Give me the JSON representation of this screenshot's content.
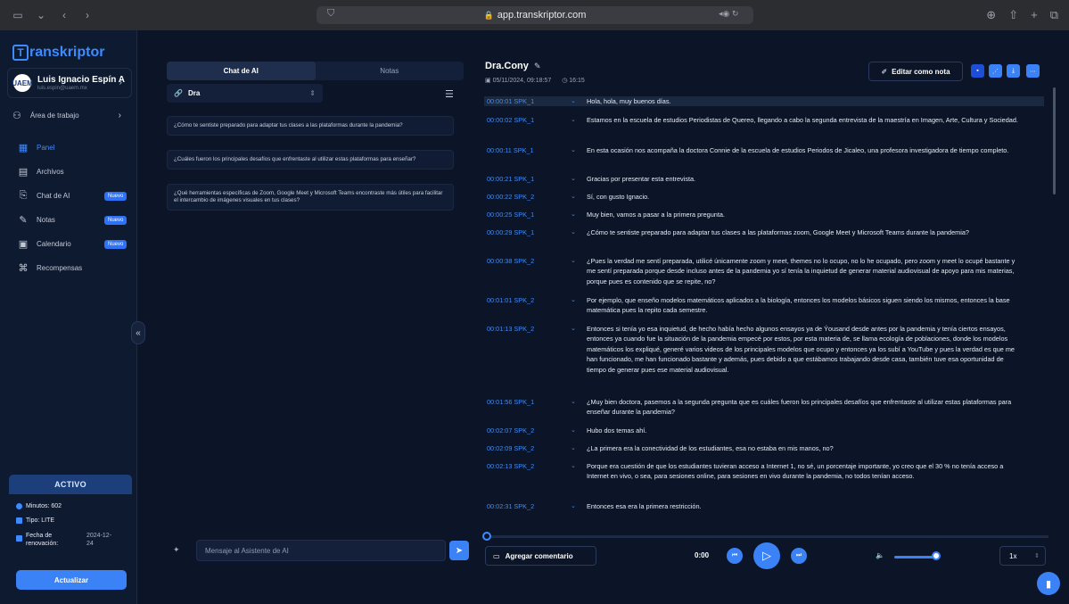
{
  "browser": {
    "url": "app.transkriptor.com"
  },
  "sidebar": {
    "logo_text": "ranskriptor",
    "logo_mark": "T",
    "user_name": "Luis Ignacio Espín A",
    "user_email": "luis.espin@uaem.mx",
    "workspace_label": "Área de trabajo",
    "nav": [
      {
        "label": "Panel",
        "icon": "grid-icon",
        "active": true,
        "badge": ""
      },
      {
        "label": "Archivos",
        "icon": "file-icon",
        "active": false,
        "badge": ""
      },
      {
        "label": "Chat de AI",
        "icon": "chat-icon",
        "active": false,
        "badge": "Nuevo"
      },
      {
        "label": "Notas",
        "icon": "note-icon",
        "active": false,
        "badge": "Nuevo"
      },
      {
        "label": "Calendario",
        "icon": "calendar-icon",
        "active": false,
        "badge": "Nuevo"
      },
      {
        "label": "Recompensas",
        "icon": "gift-icon",
        "active": false,
        "badge": ""
      }
    ],
    "plan": {
      "status": "ACTIVO",
      "minutes": "Minutos: 602",
      "type": "Tipo: LITE",
      "renewal_label": "Fecha de renovación:",
      "renewal_date": "2024-12-24",
      "upgrade": "Actualizar"
    }
  },
  "chat": {
    "tabs": [
      "Chat de AI",
      "Notas"
    ],
    "filter_value": "Dra",
    "questions": [
      "¿Cómo te sentiste preparado para adaptar tus clases a las plataformas durante la pandemia?",
      "¿Cuáles fueron los principales desafíos que enfrentaste al utilizar estas plataformas para enseñar?",
      "¿Qué herramientas específicas de Zoom, Google Meet y Microsoft Teams encontraste más útiles para facilitar el intercambio de imágenes visuales en tus clases?"
    ],
    "message_placeholder": "Mensaje al Asistente de AI"
  },
  "transcript": {
    "title": "Dra.Cony",
    "date": "05/11/2024, 09:18:57",
    "duration": "16:15",
    "edit_note": "Editar como nota",
    "lines": [
      {
        "ts": "00:00:01 SPK_1",
        "text": "Hola, hola, muy buenos días."
      },
      {
        "ts": "00:00:02 SPK_1",
        "text": "Estamos en la escuela de estudios Periodistas de Quereo, llegando a cabo la segunda entrevista de la maestría en Imagen, Arte, Cultura y Sociedad."
      },
      {
        "ts": "00:00:11 SPK_1",
        "text": "En esta ocasión nos acompaña la doctora Connie de la escuela de estudios Periodos de Jicaleo, una profesora investigadora de tiempo completo."
      },
      {
        "ts": "00:00:21 SPK_1",
        "text": "Gracias por presentar esta entrevista."
      },
      {
        "ts": "00:00:22 SPK_2",
        "text": "Sí, con gusto Ignacio."
      },
      {
        "ts": "00:00:25 SPK_1",
        "text": "Muy bien, vamos a pasar a la primera pregunta."
      },
      {
        "ts": "00:00:29 SPK_1",
        "text": "¿Cómo te sentiste preparado para adaptar tus clases a las plataformas zoom, Google Meet y Microsoft Teams durante la pandemia?"
      },
      {
        "ts": "00:00:38 SPK_2",
        "text": "¿Pues la verdad me sentí preparada, utilicé únicamente zoom y meet, themes no lo ocupo, no lo he ocupado, pero zoom y meet lo ocupé bastante y me sentí preparada porque desde incluso antes de la pandemia yo sí tenía la inquietud de generar material audiovisual de apoyo para mis materias, porque pues es contenido que se repite, no?"
      },
      {
        "ts": "00:01:01 SPK_2",
        "text": "Por ejemplo, que enseño modelos matemáticos aplicados a la biología, entonces los modelos básicos siguen siendo los mismos, entonces la base matemática pues la repito cada semestre."
      },
      {
        "ts": "00:01:13 SPK_2",
        "text": "Entonces si tenía yo esa inquietud, de hecho había hecho algunos ensayos ya de Ýousand desde antes por la pandemia y tenía ciertos ensayos, entonces ya cuando fue la situación de la pandemia empecé por estos, por esta materia de, se llama ecología de poblaciones, donde los modelos matemáticos los expliqué, generé varios videos de los principales modelos que ocupo y entonces ya los subí a YouTube y pues la verdad es que me han funcionado, me han funcionado bastante y además, pues debido a que estábamos trabajando desde casa, también tuve esa oportunidad de tiempo de generar pues ese material audiovisual."
      },
      {
        "ts": "00:01:56 SPK_1",
        "text": "¿Muy bien doctora, pasemos a la segunda pregunta que es cuáles fueron los principales desafíos que enfrentaste al utilizar estas plataformas para enseñar durante la pandemia?"
      },
      {
        "ts": "00:02:07 SPK_2",
        "text": "Hubo dos temas ahí."
      },
      {
        "ts": "00:02:09 SPK_2",
        "text": "¿La primera era la conectividad de los estudiantes, esa no estaba en mis manos, no?"
      },
      {
        "ts": "00:02:13 SPK_2",
        "text": "Porque era cuestión de que los estudiantes tuvieran acceso a Internet 1, no sé, un porcentaje importante, yo creo que el 30 % no tenía acceso a Internet en vivo, o sea, para sesiones online, para sesiones en vivo durante la pandemia, no todos tenían acceso."
      },
      {
        "ts": "00:02:31 SPK_2",
        "text": "Entonces esa era la primera restricción."
      }
    ],
    "add_comment": "Agregar comentario",
    "time": "0:00",
    "speed": "1x"
  }
}
